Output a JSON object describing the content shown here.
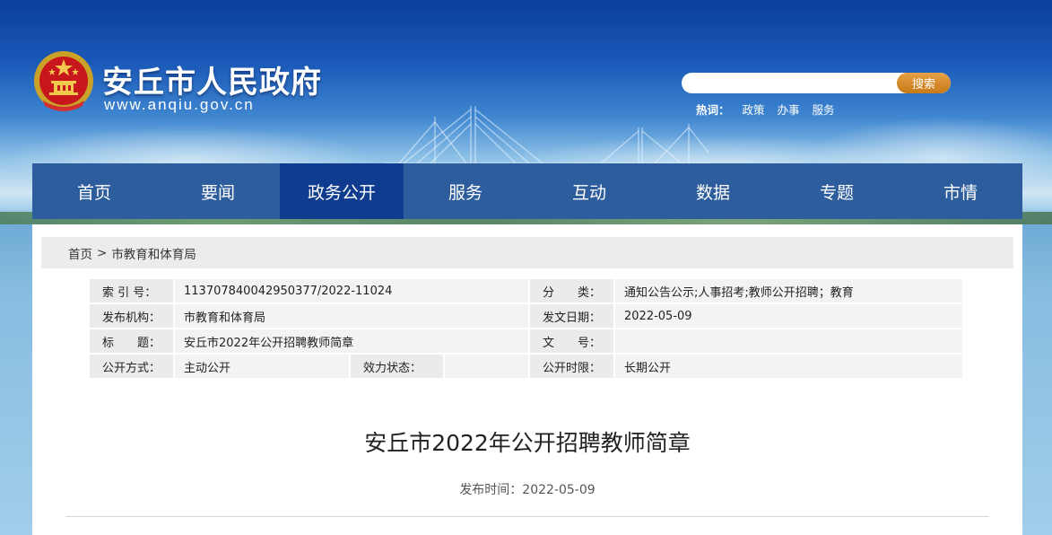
{
  "header": {
    "site_title": "安丘市人民政府",
    "site_url": "www.anqiu.gov.cn",
    "search": {
      "placeholder": "",
      "button_label": "搜索"
    },
    "hotwords": {
      "label": "热词：",
      "items": [
        "政策",
        "办事",
        "服务"
      ]
    }
  },
  "nav": {
    "items": [
      {
        "label": "首页"
      },
      {
        "label": "要闻"
      },
      {
        "label": "政务公开"
      },
      {
        "label": "服务"
      },
      {
        "label": "互动"
      },
      {
        "label": "数据"
      },
      {
        "label": "专题"
      },
      {
        "label": "市情"
      }
    ],
    "active_index": 2
  },
  "breadcrumb": {
    "home": "首页",
    "separator": ">",
    "current": "市教育和体育局"
  },
  "meta": {
    "index_label": "索 引 号：",
    "index_value": "113707840042950377/2022-11024",
    "category_label": "分　　类：",
    "category_value": "通知公告公示;人事招考;教师公开招聘；教育",
    "publisher_label": "发布机构：",
    "publisher_value": "市教育和体育局",
    "issue_date_label": "发文日期：",
    "issue_date_value": "2022-05-09",
    "title_label": "标　　题：",
    "title_value": "安丘市2022年公开招聘教师简章",
    "doc_no_label": "文　　号：",
    "doc_no_value": "",
    "open_mode_label": "公开方式：",
    "open_mode_value": "主动公开",
    "validity_label": "效力状态：",
    "validity_value": "",
    "open_period_label": "公开时限：",
    "open_period_value": "长期公开"
  },
  "article": {
    "title": "安丘市2022年公开招聘教师简章",
    "publish_time": "发布时间：2022-05-09"
  },
  "colors": {
    "nav_bg": "#2e5d9d",
    "nav_active_bg": "#0f3c8f",
    "search_button": "#d58a27",
    "breadcrumb_bg": "#ececec"
  }
}
